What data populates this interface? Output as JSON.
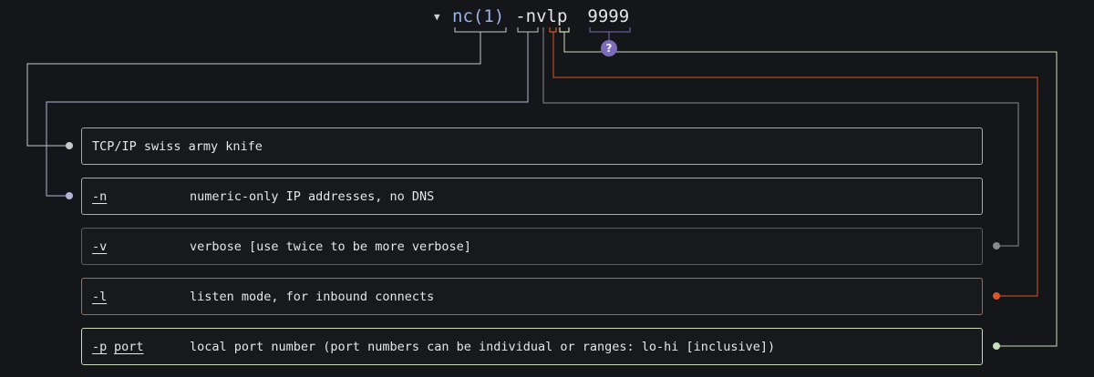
{
  "command": {
    "program": "nc(1)",
    "flags": "-nvlp",
    "argument": "9999",
    "unknown_badge": "?"
  },
  "colors": {
    "background": "#141619",
    "program_text": "#9db3e6",
    "wire_default": "#c8c8c8",
    "wire_n": "#b7b3d6",
    "wire_v": "#8a8a8a",
    "wire_l": "#d9582a",
    "wire_p": "#c7dcbc",
    "badge": "#7b6bb8"
  },
  "explanations": {
    "program": {
      "desc": "TCP/IP swiss army knife"
    },
    "n": {
      "option": "-n",
      "desc": "numeric-only IP addresses, no DNS"
    },
    "v": {
      "option": "-v",
      "desc": "verbose [use twice to be more verbose]"
    },
    "l": {
      "option": "-l",
      "desc": "listen mode, for inbound connects"
    },
    "p": {
      "option": "-p",
      "option_arg": "port",
      "desc": "local port number (port numbers can be individual or ranges: lo-hi [inclusive])"
    }
  }
}
